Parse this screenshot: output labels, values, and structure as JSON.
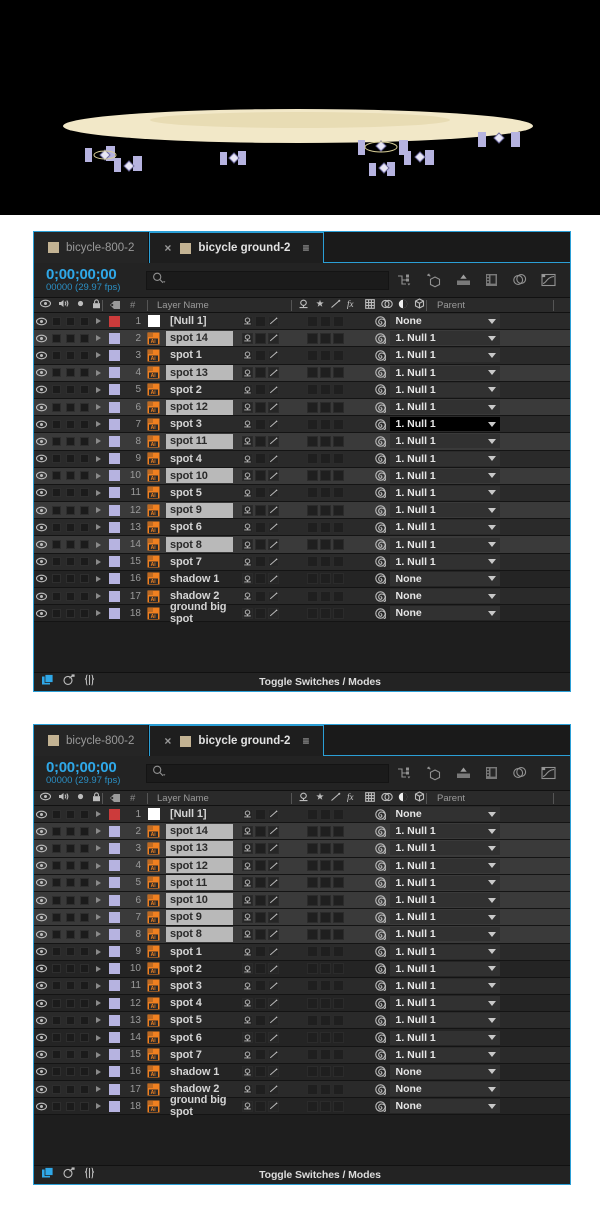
{
  "preview": {
    "name": "composition-preview",
    "background": "#000000",
    "ground_color": "#f2e8c8",
    "ground_inner_color": "#e8dcb4",
    "handle_color": "#b6b3e0"
  },
  "panels": [
    {
      "id": "panel-1",
      "tabs": [
        {
          "label": "bicycle-800-2",
          "active": false,
          "closable": false
        },
        {
          "label": "bicycle ground-2",
          "active": true,
          "closable": true
        }
      ],
      "toolbar": {
        "timecode": "0;00;00;00",
        "frames_fps": "00000 (29.97 fps)",
        "search_placeholder": "",
        "search_value": "",
        "icons": [
          "graph-connector-icon",
          "3d-renderer-icon",
          "motion-blur-icon",
          "frame-blend-icon",
          "draft-3d-icon",
          "graph-editor-icon"
        ]
      },
      "columns": {
        "video": "eye-icon",
        "audio": "speaker-icon",
        "solo": "solo-dot-icon",
        "lock": "lock-icon",
        "label": "label-tag-icon",
        "number": "#",
        "name": "Layer Name",
        "switches": [
          "shy-icon",
          "collapse-star-icon",
          "quality-icon",
          "fx-icon",
          "frame-blend-icon",
          "motion-blur-icon",
          "adjustment-icon",
          "3d-layer-icon"
        ],
        "parent": "Parent"
      },
      "rows": [
        {
          "num": "1",
          "name": "[Null 1]",
          "color": "#cc3b3b",
          "selected": false,
          "icon": "null-square-icon",
          "parent": "None",
          "parent_focus": false
        },
        {
          "num": "2",
          "name": "spot 14",
          "color": "#b6b3e0",
          "selected": true,
          "icon": "ai-file-icon",
          "parent": "1. Null 1",
          "parent_focus": false
        },
        {
          "num": "3",
          "name": "spot 1",
          "color": "#b6b3e0",
          "selected": false,
          "icon": "ai-file-icon",
          "parent": "1. Null 1",
          "parent_focus": false
        },
        {
          "num": "4",
          "name": "spot 13",
          "color": "#b6b3e0",
          "selected": true,
          "icon": "ai-file-icon",
          "parent": "1. Null 1",
          "parent_focus": false
        },
        {
          "num": "5",
          "name": "spot 2",
          "color": "#b6b3e0",
          "selected": false,
          "icon": "ai-file-icon",
          "parent": "1. Null 1",
          "parent_focus": false
        },
        {
          "num": "6",
          "name": "spot 12",
          "color": "#b6b3e0",
          "selected": true,
          "icon": "ai-file-icon",
          "parent": "1. Null 1",
          "parent_focus": false
        },
        {
          "num": "7",
          "name": "spot 3",
          "color": "#b6b3e0",
          "selected": false,
          "icon": "ai-file-icon",
          "parent": "1. Null 1",
          "parent_focus": true
        },
        {
          "num": "8",
          "name": "spot 11",
          "color": "#b6b3e0",
          "selected": true,
          "icon": "ai-file-icon",
          "parent": "1. Null 1",
          "parent_focus": false
        },
        {
          "num": "9",
          "name": "spot 4",
          "color": "#b6b3e0",
          "selected": false,
          "icon": "ai-file-icon",
          "parent": "1. Null 1",
          "parent_focus": false
        },
        {
          "num": "10",
          "name": "spot 10",
          "color": "#b6b3e0",
          "selected": true,
          "icon": "ai-file-icon",
          "parent": "1. Null 1",
          "parent_focus": false
        },
        {
          "num": "11",
          "name": "spot 5",
          "color": "#b6b3e0",
          "selected": false,
          "icon": "ai-file-icon",
          "parent": "1. Null 1",
          "parent_focus": false
        },
        {
          "num": "12",
          "name": "spot 9",
          "color": "#b6b3e0",
          "selected": true,
          "icon": "ai-file-icon",
          "parent": "1. Null 1",
          "parent_focus": false
        },
        {
          "num": "13",
          "name": "spot 6",
          "color": "#b6b3e0",
          "selected": false,
          "icon": "ai-file-icon",
          "parent": "1. Null 1",
          "parent_focus": false
        },
        {
          "num": "14",
          "name": "spot 8",
          "color": "#b6b3e0",
          "selected": true,
          "icon": "ai-file-icon",
          "parent": "1. Null 1",
          "parent_focus": false
        },
        {
          "num": "15",
          "name": "spot 7",
          "color": "#b6b3e0",
          "selected": false,
          "icon": "ai-file-icon",
          "parent": "1. Null 1",
          "parent_focus": false
        },
        {
          "num": "16",
          "name": "shadow 1",
          "color": "#b6b3e0",
          "selected": false,
          "icon": "ai-file-icon",
          "parent": "None",
          "parent_focus": false
        },
        {
          "num": "17",
          "name": "shadow 2",
          "color": "#b6b3e0",
          "selected": false,
          "icon": "ai-file-icon",
          "parent": "None",
          "parent_focus": false
        },
        {
          "num": "18",
          "name": "ground big spot",
          "color": "#b6b3e0",
          "selected": false,
          "icon": "ai-file-icon",
          "parent": "None",
          "parent_focus": false
        }
      ],
      "statusbar": {
        "label": "Toggle Switches / Modes",
        "icons": [
          "comp-mini-flowchart-icon",
          "comp-render-icon",
          "expand-switches-icon"
        ]
      }
    },
    {
      "id": "panel-2",
      "tabs": [
        {
          "label": "bicycle-800-2",
          "active": false,
          "closable": false
        },
        {
          "label": "bicycle ground-2",
          "active": true,
          "closable": true
        }
      ],
      "toolbar": {
        "timecode": "0;00;00;00",
        "frames_fps": "00000 (29.97 fps)",
        "search_placeholder": "",
        "search_value": "",
        "icons": [
          "graph-connector-icon",
          "3d-renderer-icon",
          "motion-blur-icon",
          "frame-blend-icon",
          "draft-3d-icon",
          "graph-editor-icon"
        ]
      },
      "columns": {
        "video": "eye-icon",
        "audio": "speaker-icon",
        "solo": "solo-dot-icon",
        "lock": "lock-icon",
        "label": "label-tag-icon",
        "number": "#",
        "name": "Layer Name",
        "switches": [
          "shy-icon",
          "collapse-star-icon",
          "quality-icon",
          "fx-icon",
          "frame-blend-icon",
          "motion-blur-icon",
          "adjustment-icon",
          "3d-layer-icon"
        ],
        "parent": "Parent"
      },
      "rows": [
        {
          "num": "1",
          "name": "[Null 1]",
          "color": "#cc3b3b",
          "selected": false,
          "icon": "null-square-icon",
          "parent": "None",
          "parent_focus": false
        },
        {
          "num": "2",
          "name": "spot 14",
          "color": "#b6b3e0",
          "selected": true,
          "icon": "ai-file-icon",
          "parent": "1. Null 1",
          "parent_focus": false
        },
        {
          "num": "3",
          "name": "spot 13",
          "color": "#b6b3e0",
          "selected": true,
          "icon": "ai-file-icon",
          "parent": "1. Null 1",
          "parent_focus": false
        },
        {
          "num": "4",
          "name": "spot 12",
          "color": "#b6b3e0",
          "selected": true,
          "icon": "ai-file-icon",
          "parent": "1. Null 1",
          "parent_focus": false
        },
        {
          "num": "5",
          "name": "spot 11",
          "color": "#b6b3e0",
          "selected": true,
          "icon": "ai-file-icon",
          "parent": "1. Null 1",
          "parent_focus": false
        },
        {
          "num": "6",
          "name": "spot 10",
          "color": "#b6b3e0",
          "selected": true,
          "icon": "ai-file-icon",
          "parent": "1. Null 1",
          "parent_focus": false
        },
        {
          "num": "7",
          "name": "spot 9",
          "color": "#b6b3e0",
          "selected": true,
          "icon": "ai-file-icon",
          "parent": "1. Null 1",
          "parent_focus": false
        },
        {
          "num": "8",
          "name": "spot 8",
          "color": "#b6b3e0",
          "selected": true,
          "icon": "ai-file-icon",
          "parent": "1. Null 1",
          "parent_focus": false
        },
        {
          "num": "9",
          "name": "spot 1",
          "color": "#b6b3e0",
          "selected": false,
          "icon": "ai-file-icon",
          "parent": "1. Null 1",
          "parent_focus": false
        },
        {
          "num": "10",
          "name": "spot 2",
          "color": "#b6b3e0",
          "selected": false,
          "icon": "ai-file-icon",
          "parent": "1. Null 1",
          "parent_focus": false
        },
        {
          "num": "11",
          "name": "spot 3",
          "color": "#b6b3e0",
          "selected": false,
          "icon": "ai-file-icon",
          "parent": "1. Null 1",
          "parent_focus": false
        },
        {
          "num": "12",
          "name": "spot 4",
          "color": "#b6b3e0",
          "selected": false,
          "icon": "ai-file-icon",
          "parent": "1. Null 1",
          "parent_focus": false
        },
        {
          "num": "13",
          "name": "spot 5",
          "color": "#b6b3e0",
          "selected": false,
          "icon": "ai-file-icon",
          "parent": "1. Null 1",
          "parent_focus": false
        },
        {
          "num": "14",
          "name": "spot 6",
          "color": "#b6b3e0",
          "selected": false,
          "icon": "ai-file-icon",
          "parent": "1. Null 1",
          "parent_focus": false
        },
        {
          "num": "15",
          "name": "spot 7",
          "color": "#b6b3e0",
          "selected": false,
          "icon": "ai-file-icon",
          "parent": "1. Null 1",
          "parent_focus": false
        },
        {
          "num": "16",
          "name": "shadow 1",
          "color": "#b6b3e0",
          "selected": false,
          "icon": "ai-file-icon",
          "parent": "None",
          "parent_focus": false
        },
        {
          "num": "17",
          "name": "shadow 2",
          "color": "#b6b3e0",
          "selected": false,
          "icon": "ai-file-icon",
          "parent": "None",
          "parent_focus": false
        },
        {
          "num": "18",
          "name": "ground big spot",
          "color": "#b6b3e0",
          "selected": false,
          "icon": "ai-file-icon",
          "parent": "None",
          "parent_focus": false
        }
      ],
      "statusbar": {
        "label": "Toggle Switches / Modes",
        "icons": [
          "comp-mini-flowchart-icon",
          "comp-render-icon",
          "expand-switches-icon"
        ]
      }
    }
  ]
}
